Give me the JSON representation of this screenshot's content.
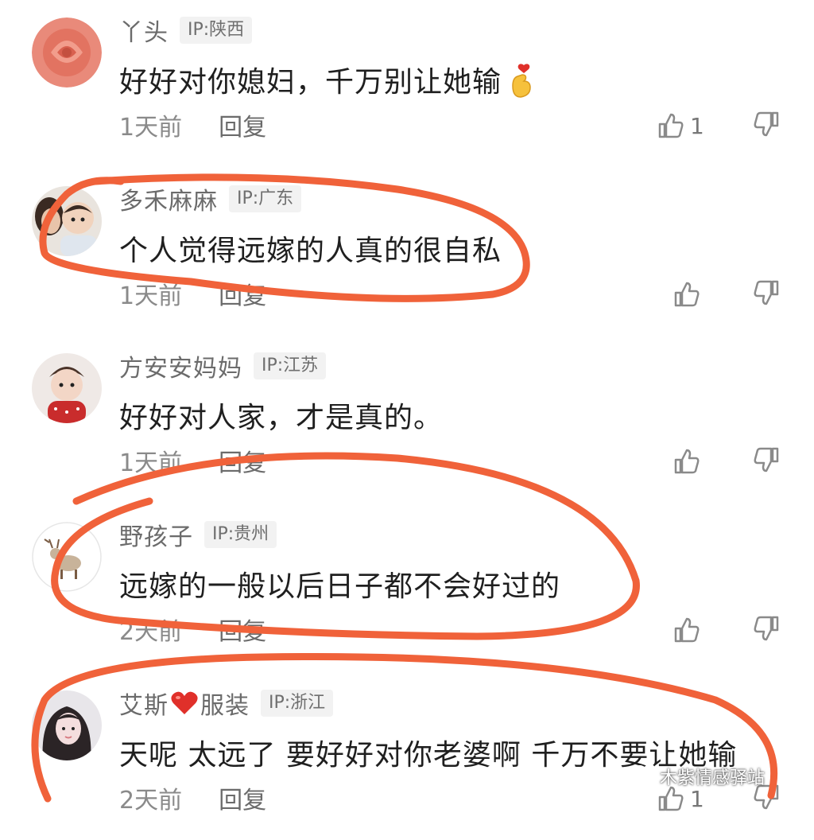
{
  "comments": [
    {
      "username": "丫头",
      "ip": "IP:陕西",
      "text": "好好对你媳妇，千万别让她输",
      "time": "1天前",
      "reply_label": "回复",
      "likes": "1",
      "avatar_icon": "rose-avatar",
      "text_emoji": "finger-heart-emoji"
    },
    {
      "username": "多禾麻麻",
      "ip": "IP:广东",
      "text": "个人觉得远嫁的人真的很自私",
      "time": "1天前",
      "reply_label": "回复",
      "likes": "",
      "avatar_icon": "mother-child-avatar"
    },
    {
      "username": "方安安妈妈",
      "ip": "IP:江苏",
      "text": "好好对人家，才是真的。",
      "time": "1天前",
      "reply_label": "回复",
      "likes": "",
      "avatar_icon": "baby-avatar"
    },
    {
      "username": "野孩子",
      "ip": "IP:贵州",
      "text": "远嫁的一般以后日子都不会好过的",
      "time": "2天前",
      "reply_label": "回复",
      "likes": "",
      "avatar_icon": "deer-avatar"
    },
    {
      "username_prefix": "艾斯",
      "username_suffix": "服装",
      "ip": "IP:浙江",
      "text": "天呢 太远了 要好好对你老婆啊 千万不要让她输",
      "time": "2天前",
      "reply_label": "回复",
      "likes": "1",
      "avatar_icon": "girl-avatar",
      "name_emoji": "red-heart-emoji"
    }
  ],
  "watermark": "木紫情感驿站",
  "colors": {
    "annotation_stroke": "#f0623a",
    "heart": "#e0302a"
  }
}
